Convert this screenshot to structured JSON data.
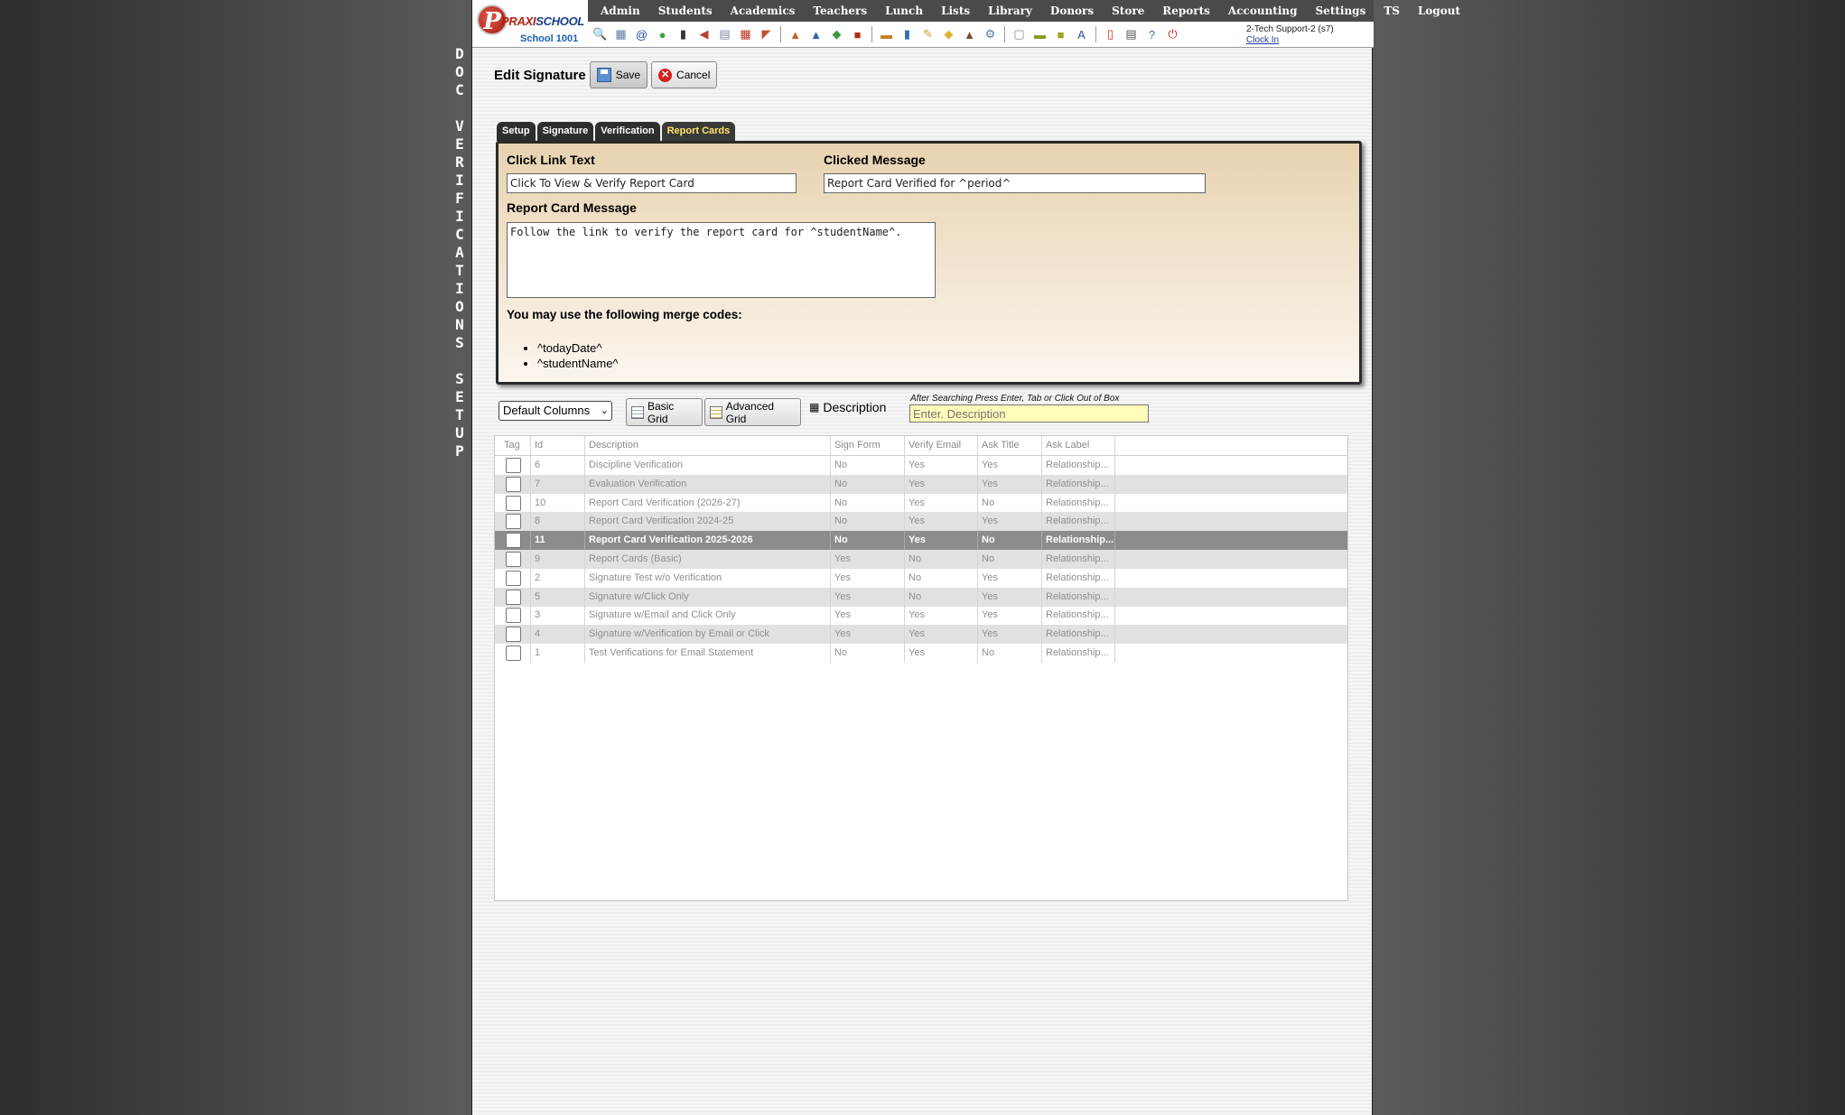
{
  "app": {
    "logo_brand": "PRAXISCHOOL",
    "logo_brand_a": "PRAXI",
    "logo_brand_b": "SCHOOL",
    "school": "School 1001"
  },
  "menu": [
    "Admin",
    "Students",
    "Academics",
    "Teachers",
    "Lunch",
    "Lists",
    "Library",
    "Donors",
    "Store",
    "Reports",
    "Accounting",
    "Settings",
    "TS",
    "Logout"
  ],
  "toolbar_icons": [
    {
      "name": "search-icon",
      "glyph": "🔍",
      "color": "#6a8fc0"
    },
    {
      "name": "grid-icon",
      "glyph": "▦",
      "color": "#5a7aa0"
    },
    {
      "name": "email-icon",
      "glyph": "@",
      "color": "#1d4fa8"
    },
    {
      "name": "chat-icon",
      "glyph": "●",
      "color": "#3aa33a"
    },
    {
      "name": "mobile-icon",
      "glyph": "▮",
      "color": "#333333"
    },
    {
      "name": "speaker-icon",
      "glyph": "◀",
      "color": "#c04030"
    },
    {
      "name": "list-icon",
      "glyph": "▤",
      "color": "#7a8aa0"
    },
    {
      "name": "calendar-icon",
      "glyph": "▦",
      "color": "#c03020"
    },
    {
      "name": "megaphone-icon",
      "glyph": "◤",
      "color": "#c05030"
    },
    {
      "name": "separator"
    },
    {
      "name": "teacher-icon",
      "glyph": "▲",
      "color": "#c06030"
    },
    {
      "name": "student-icon",
      "glyph": "▲",
      "color": "#3060b0"
    },
    {
      "name": "money-icon",
      "glyph": "◆",
      "color": "#3a9a3a"
    },
    {
      "name": "bus-icon",
      "glyph": "■",
      "color": "#b03020"
    },
    {
      "name": "separator"
    },
    {
      "name": "card-icon",
      "glyph": "▬",
      "color": "#c08020"
    },
    {
      "name": "book-icon",
      "glyph": "▮",
      "color": "#3a6ab0"
    },
    {
      "name": "pencil-icon",
      "glyph": "✎",
      "color": "#d0a020"
    },
    {
      "name": "tag-icon",
      "glyph": "◆",
      "color": "#e0b030"
    },
    {
      "name": "people-icon",
      "glyph": "▲",
      "color": "#7a4a2a"
    },
    {
      "name": "gear-icon",
      "glyph": "⚙",
      "color": "#5a7aa0"
    },
    {
      "name": "separator"
    },
    {
      "name": "window-icon",
      "glyph": "▢",
      "color": "#7a8aa0"
    },
    {
      "name": "ruler-icon",
      "glyph": "▬",
      "color": "#8a9a20"
    },
    {
      "name": "bus2-icon",
      "glyph": "■",
      "color": "#a0a020"
    },
    {
      "name": "ap-icon",
      "glyph": "A",
      "color": "#3050a0"
    },
    {
      "name": "separator"
    },
    {
      "name": "pdf-icon",
      "glyph": "▯",
      "color": "#c03020"
    },
    {
      "name": "printer-icon",
      "glyph": "▤",
      "color": "#555555"
    },
    {
      "name": "help-icon",
      "glyph": "?",
      "color": "#3a6ab0"
    },
    {
      "name": "power-icon",
      "glyph": "⏻",
      "color": "#c02020"
    }
  ],
  "user": {
    "name": "2-Tech Support-2 (s7)",
    "clock_link": "Clock In"
  },
  "side_label": "DOC VERIFICATIONS SETUP",
  "page": {
    "title": "Edit Signature",
    "save_label": "Save",
    "cancel_label": "Cancel"
  },
  "tabs": [
    {
      "label": "Setup",
      "active": false
    },
    {
      "label": "Signature",
      "active": false
    },
    {
      "label": "Verification",
      "active": false
    },
    {
      "label": "Report Cards",
      "active": true
    }
  ],
  "form": {
    "click_link_label": "Click Link Text",
    "click_link_value": "Click To View & Verify Report Card",
    "clicked_message_label": "Clicked Message",
    "clicked_message_value": "Report Card Verified for ^period^",
    "report_message_label": "Report Card Message",
    "report_message_value": "Follow the link to verify the report card for ^studentName^.",
    "merge_intro": "You may use the following merge codes:",
    "merge_codes": [
      "^todayDate^",
      "^studentName^"
    ]
  },
  "search": {
    "columns_select": "Default Columns",
    "basic_grid": "Basic Grid",
    "advanced_grid": "Advanced Grid",
    "description_label": "Description",
    "hint": "After Searching Press Enter, Tab or Click Out of Box",
    "placeholder": "Enter. Description"
  },
  "grid": {
    "columns": [
      "Tag",
      "Id",
      "Description",
      "Sign Form",
      "Verify Email",
      "Ask Title",
      "Ask Label"
    ],
    "rows": [
      {
        "id": "6",
        "desc": "Discipline Verification",
        "sign": "No",
        "verify": "Yes",
        "title": "Yes",
        "label": "Relationship..."
      },
      {
        "id": "7",
        "desc": "Evaluation Verification",
        "sign": "No",
        "verify": "Yes",
        "title": "Yes",
        "label": "Relationship..."
      },
      {
        "id": "10",
        "desc": "Report Card Verification (2026-27)",
        "sign": "No",
        "verify": "Yes",
        "title": "No",
        "label": "Relationship..."
      },
      {
        "id": "8",
        "desc": "Report Card Verification 2024-25",
        "sign": "No",
        "verify": "Yes",
        "title": "Yes",
        "label": "Relationship..."
      },
      {
        "id": "11",
        "desc": "Report Card Verification 2025-2026",
        "sign": "No",
        "verify": "Yes",
        "title": "No",
        "label": "Relationship...",
        "selected": true
      },
      {
        "id": "9",
        "desc": "Report Cards (Basic)",
        "sign": "Yes",
        "verify": "No",
        "title": "No",
        "label": "Relationship..."
      },
      {
        "id": "2",
        "desc": "Signature Test w/o Verification",
        "sign": "Yes",
        "verify": "No",
        "title": "Yes",
        "label": "Relationship..."
      },
      {
        "id": "5",
        "desc": "Signature w/Click Only",
        "sign": "Yes",
        "verify": "No",
        "title": "Yes",
        "label": "Relationship..."
      },
      {
        "id": "3",
        "desc": "Signature w/Email and Click Only",
        "sign": "Yes",
        "verify": "Yes",
        "title": "Yes",
        "label": "Relationship..."
      },
      {
        "id": "4",
        "desc": "Signature w/Verification by Email or Click",
        "sign": "Yes",
        "verify": "Yes",
        "title": "Yes",
        "label": "Relationship..."
      },
      {
        "id": "1",
        "desc": "Test Verifications for Email Statement",
        "sign": "No",
        "verify": "Yes",
        "title": "No",
        "label": "Relationship..."
      }
    ]
  }
}
